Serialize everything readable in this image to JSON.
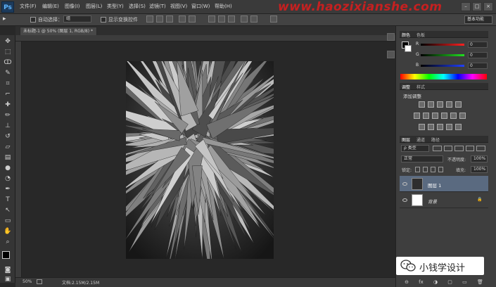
{
  "app": {
    "logo": "Ps"
  },
  "menu": [
    "文件(F)",
    "编辑(E)",
    "图像(I)",
    "图层(L)",
    "类型(Y)",
    "选择(S)",
    "滤镜(T)",
    "视图(V)",
    "窗口(W)",
    "帮助(H)"
  ],
  "watermark": "www.haozixianshe.com",
  "window_controls": [
    "–",
    "□",
    "×"
  ],
  "options": {
    "auto_select_label": "自动选择：",
    "auto_select_value": "组",
    "show_transform_label": "显示变换控件",
    "workspace": "基本功能"
  },
  "document": {
    "tab_title": "未标题-1 @ 50% (图层 1, RGB/8) *",
    "tab_close": "×",
    "zoom": "50%",
    "doc_info": "文档:2.15M/2.15M"
  },
  "color_panel": {
    "tabs": [
      "颜色",
      "色板"
    ],
    "channels": [
      {
        "label": "R",
        "value": "0",
        "color": "#e02020"
      },
      {
        "label": "G",
        "value": "0",
        "color": "#20c020"
      },
      {
        "label": "B",
        "value": "0",
        "color": "#2040e0"
      }
    ]
  },
  "adjust_panel": {
    "tabs": [
      "调整",
      "样式"
    ],
    "title": "添加调整"
  },
  "layers_panel": {
    "tabs": [
      "图层",
      "通道",
      "路径"
    ],
    "filter": "ρ 类型",
    "blend_mode": "正常",
    "opacity_label": "不透明度:",
    "opacity_value": "100%",
    "lock_label": "锁定:",
    "fill_label": "填充:",
    "fill_value": "100%",
    "layers": [
      {
        "name": "图层 1",
        "selected": true
      },
      {
        "name": "背景",
        "selected": false,
        "lock": "🔒"
      }
    ],
    "bottom_icons": [
      "⊖",
      "fx",
      "◑",
      "▢",
      "▭",
      "🗑"
    ]
  },
  "wechat": {
    "label": "小钱学设计",
    "icon": "wechat-icon"
  },
  "colors": {
    "accent": "#5fb7ff",
    "layer_selected": "#5a6a80",
    "watermark": "#c62020"
  }
}
